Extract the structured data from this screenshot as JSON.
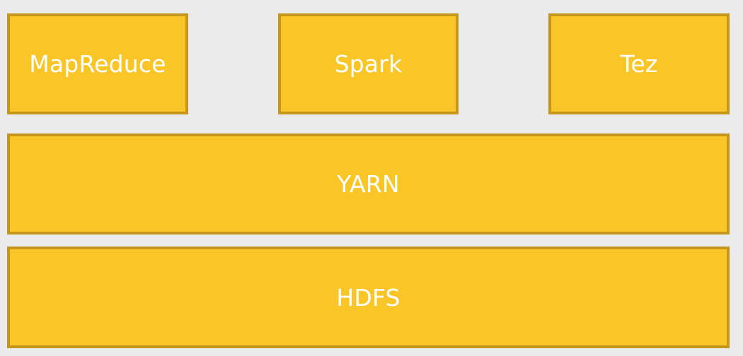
{
  "diagram": {
    "top_row": [
      {
        "label": "MapReduce"
      },
      {
        "label": "Spark"
      },
      {
        "label": "Tez"
      }
    ],
    "middle": {
      "label": "YARN"
    },
    "bottom": {
      "label": "HDFS"
    }
  },
  "colors": {
    "background": "#ebebeb",
    "block_fill": "#f9c527",
    "block_border": "#c4961c",
    "text": "#ffffff"
  }
}
